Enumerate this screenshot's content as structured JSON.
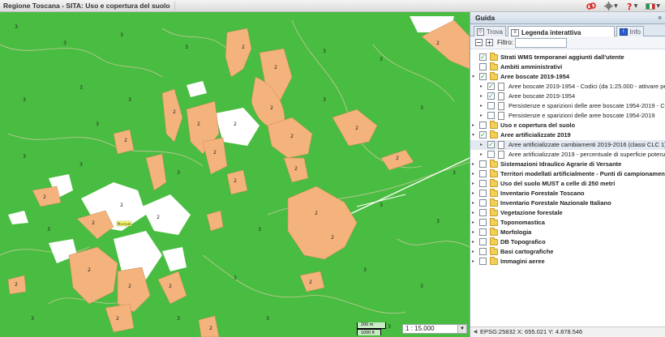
{
  "app": {
    "title": "Regione Toscana - SITA: Uso e copertura del suolo"
  },
  "header_icons": [
    {
      "name": "links-icon"
    },
    {
      "name": "gear-icon"
    },
    {
      "name": "help-icon"
    },
    {
      "name": "italy-flag-icon"
    }
  ],
  "colors": {
    "map_green": "#49bd41",
    "artificial_orange": "#f4b37d",
    "unclassified_white": "#ffffff",
    "road_line": "#d7c9a6"
  },
  "map": {
    "scale_top": "200 m",
    "scale_bottom": "1000 ft",
    "scale_value": "1 : 15.000",
    "place_label": "Montale",
    "polygon_label_2": "2",
    "polygon_label_3": "3"
  },
  "panel": {
    "title": "Guida",
    "collapse": "»",
    "tabs": [
      {
        "label": "Trova",
        "active": false
      },
      {
        "label": "Legenda interattiva",
        "active": true
      },
      {
        "label": "Info",
        "active": false
      }
    ],
    "filter_label": "Filtro:",
    "filter_value": "",
    "coords": "EPSG:25832  X: 655.021  Y: 4.878.546"
  },
  "layers": [
    {
      "label": "Strati WMS temporanei aggiunti dall'utente",
      "type": "folder",
      "level": 0,
      "checked": true,
      "expander": ""
    },
    {
      "label": "Ambiti amministrativi",
      "type": "folder",
      "level": 0,
      "checked": false,
      "expander": ""
    },
    {
      "label": "Aree boscate 2019-1954",
      "type": "folder",
      "level": 0,
      "checked": true,
      "expander": "▾"
    },
    {
      "label": "Aree boscate 2019-1954 - Codici (da 1:25.000 - attivare per interrog",
      "type": "doc",
      "level": 1,
      "checked": true,
      "expander": "▸"
    },
    {
      "label": "Aree boscate 2019-1954",
      "type": "doc",
      "level": 1,
      "checked": true,
      "expander": "▸"
    },
    {
      "label": "Persistenze e sparizioni delle aree boscate 1954-2019 - Codici (da 1:2",
      "type": "doc",
      "level": 1,
      "checked": false,
      "expander": "▸"
    },
    {
      "label": "Persistenze e sparizioni delle aree boscate 1954-2019",
      "type": "doc",
      "level": 1,
      "checked": false,
      "expander": "▸"
    },
    {
      "label": "Uso e copertura del suolo",
      "type": "folder",
      "level": 0,
      "checked": false,
      "expander": "▸"
    },
    {
      "label": "Aree artificializzate 2019",
      "type": "folder",
      "level": 0,
      "checked": true,
      "expander": "▾"
    },
    {
      "label": "Aree artificializzate cambiamenti 2019-2016 (classi CLC 1)- (scala 1:2",
      "type": "doc",
      "level": 1,
      "checked": true,
      "expander": "▸",
      "selected": true
    },
    {
      "label": "Aree artificializzate 2019 - percentuale di superficie potenzialmente in",
      "type": "doc",
      "level": 1,
      "checked": false,
      "expander": "▸"
    },
    {
      "label": "Sistemazioni Idraulico Agrarie di Versante",
      "type": "folder",
      "level": 0,
      "checked": false,
      "expander": "▸"
    },
    {
      "label": "Territori modellati artificialmente - Punti di campionamento",
      "type": "folder",
      "level": 0,
      "checked": false,
      "expander": "▸"
    },
    {
      "label": "Uso del suolo MUST a celle di 250 metri",
      "type": "folder",
      "level": 0,
      "checked": false,
      "expander": "▸"
    },
    {
      "label": "Inventario Forestale Toscano",
      "type": "folder",
      "level": 0,
      "checked": false,
      "expander": "▸"
    },
    {
      "label": "Inventario Forestale Nazionale Italiano",
      "type": "folder",
      "level": 0,
      "checked": false,
      "expander": "▸"
    },
    {
      "label": "Vegetazione forestale",
      "type": "folder",
      "level": 0,
      "checked": false,
      "expander": "▸"
    },
    {
      "label": "Toponomastica",
      "type": "folder",
      "level": 0,
      "checked": false,
      "expander": "▸"
    },
    {
      "label": "Morfologia",
      "type": "folder",
      "level": 0,
      "checked": false,
      "expander": "▸"
    },
    {
      "label": "DB Topografico",
      "type": "folder",
      "level": 0,
      "checked": false,
      "expander": "▸"
    },
    {
      "label": "Basi cartografiche",
      "type": "folder",
      "level": 0,
      "checked": false,
      "expander": "▸"
    },
    {
      "label": "Immagini aeree",
      "type": "folder",
      "level": 0,
      "checked": false,
      "expander": "▸"
    }
  ]
}
